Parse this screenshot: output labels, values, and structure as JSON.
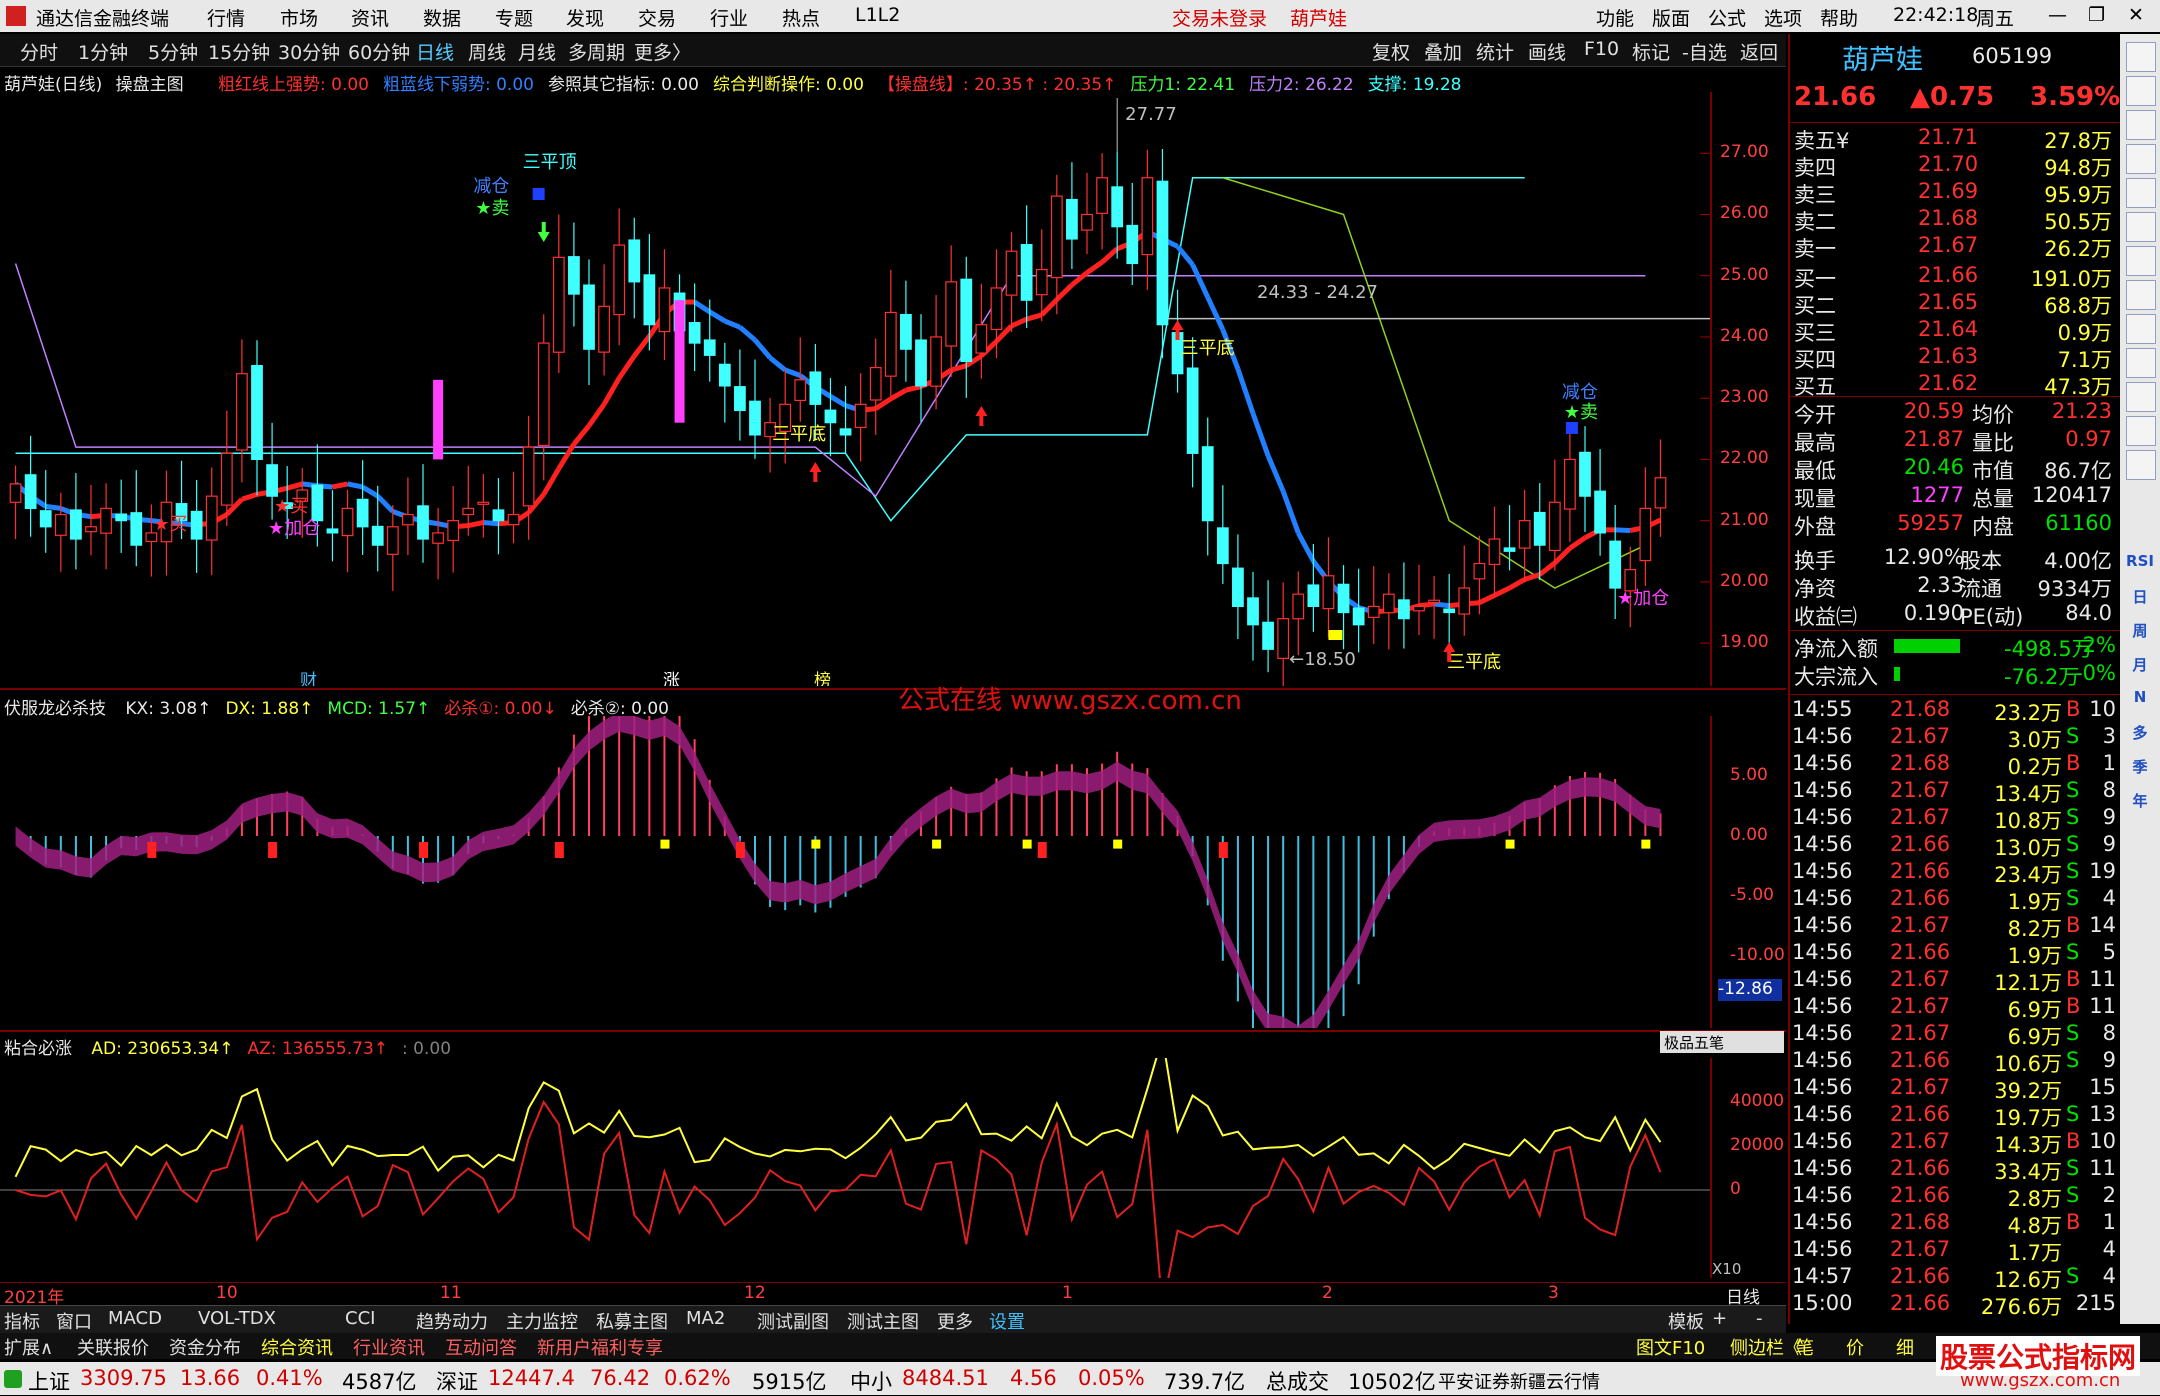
{
  "menubar": {
    "app_title": "通达信金融终端",
    "items": [
      "行情",
      "市场",
      "资讯",
      "数据",
      "专题",
      "发现",
      "交易",
      "行业",
      "热点",
      "L1L2"
    ],
    "trade_status": "交易未登录",
    "stock_name": "葫芦娃",
    "right_items": [
      "功能",
      "版面",
      "公式",
      "选项",
      "帮助"
    ],
    "time": "22:42:18",
    "weekday": "周五"
  },
  "timeframe_bar": {
    "items": [
      "分时",
      "1分钟",
      "5分钟",
      "15分钟",
      "30分钟",
      "60分钟",
      "日线",
      "周线",
      "月线",
      "多周期",
      "更多〉"
    ],
    "active": "日线",
    "right_items": [
      "复权",
      "叠加",
      "统计",
      "画线",
      "F10",
      "标记",
      "-自选",
      "返回"
    ]
  },
  "main_chart": {
    "title": "葫芦娃(日线)",
    "indicator_name": "操盘主图",
    "params": [
      {
        "text": "粗红线上强势: 0.00",
        "color": "#ff3030"
      },
      {
        "text": "粗蓝线下弱势: 0.00",
        "color": "#3080ff"
      },
      {
        "text": "参照其它指标: 0.00",
        "color": "#e8e8e8"
      },
      {
        "text": "综合判断操作: 0.00",
        "color": "#ffff40"
      },
      {
        "text": "【操盘线】: 20.35↑ : 20.35↑",
        "color": "#ff3030"
      },
      {
        "text": "压力1: 22.41",
        "color": "#40ff40"
      },
      {
        "text": "压力2: 26.22",
        "color": "#c080ff"
      },
      {
        "text": "支撑: 19.28",
        "color": "#40ffff"
      }
    ],
    "y_ticks": [
      "27.00",
      "26.00",
      "25.00",
      "24.00",
      "23.00",
      "22.00",
      "21.00",
      "20.00",
      "19.00"
    ],
    "annotations": {
      "high": "27.77",
      "low": "←18.50",
      "range": "24.33 - 24.27",
      "three_top": "三平顶",
      "three_bottom": "三平底",
      "reduce": "减仓",
      "sell": "★卖",
      "buy": "★买",
      "add": "★加仓",
      "cai": "财",
      "zhang": "涨",
      "bang": "榜"
    }
  },
  "chart_data": [
    {
      "type": "candlestick",
      "title": "葫芦娃(日线)",
      "y_ticks": [
        27.0,
        26.0,
        25.0,
        24.0,
        23.0,
        22.0,
        21.0,
        20.0,
        19.0
      ],
      "ylim": [
        18.3,
        28.0
      ],
      "x_ticks": [
        "2021年",
        "10",
        "11",
        "12",
        "1",
        "2",
        "3"
      ],
      "marked_high": 27.77,
      "marked_low": 18.5,
      "closes": [
        21.6,
        21.2,
        20.9,
        21.1,
        20.7,
        20.9,
        21.2,
        21.0,
        20.6,
        20.8,
        21.3,
        21.0,
        20.7,
        21.4,
        22.1,
        23.4,
        22.0,
        21.4,
        21.2,
        21.5,
        21.0,
        20.8,
        21.2,
        20.9,
        20.6,
        20.9,
        21.1,
        20.7,
        20.8,
        21.0,
        21.2,
        21.3,
        21.0,
        21.1,
        22.2,
        23.9,
        25.3,
        24.7,
        23.8,
        24.5,
        25.5,
        24.9,
        24.2,
        24.8,
        24.1,
        23.9,
        23.7,
        23.2,
        22.8,
        22.4,
        22.6,
        22.9,
        23.3,
        22.9,
        22.6,
        22.4,
        22.9,
        23.5,
        24.4,
        23.8,
        23.2,
        24.0,
        24.9,
        23.6,
        24.2,
        24.8,
        25.4,
        24.6,
        25.1,
        26.3,
        25.6,
        26.0,
        26.6,
        25.8,
        25.2,
        26.6,
        24.2,
        23.4,
        22.1,
        21.0,
        20.3,
        19.6,
        19.3,
        18.9,
        19.4,
        19.8,
        19.6,
        20.1,
        19.5,
        19.3,
        19.6,
        19.8,
        19.4,
        19.6,
        19.7,
        19.5,
        19.9,
        20.3,
        20.7,
        20.5,
        21.0,
        20.6,
        21.3,
        22.0,
        21.4,
        20.8,
        19.9,
        20.2,
        21.2,
        21.7
      ],
      "series": [
        {
          "name": "操盘线",
          "values_ref": "closes"
        },
        {
          "name": "压力1",
          "value": 22.41
        },
        {
          "name": "压力2",
          "value": 26.22
        },
        {
          "name": "支撑",
          "value": 19.28
        }
      ]
    },
    {
      "type": "bar",
      "title": "伏服龙必杀技",
      "params": {
        "KX": 3.08,
        "DX": 1.88,
        "MCD": 1.57,
        "必杀①": 0.0,
        "必杀②": 0.0
      },
      "y_ticks": [
        5.0,
        0.0,
        -5.0,
        -10.0
      ],
      "current_value": -12.86,
      "ylim": [
        -16,
        10
      ]
    },
    {
      "type": "line",
      "title": "粘合必涨",
      "params": {
        "AD": 230653.34,
        "AZ": 136555.73
      },
      "y_ticks": [
        40000,
        20000,
        0
      ],
      "scale": "X10"
    }
  ],
  "indicator1": {
    "title": "伏服龙必杀技",
    "params": [
      {
        "text": "KX: 3.08↑",
        "color": "#e8e8e8"
      },
      {
        "text": "DX: 1.88↑",
        "color": "#ffff40"
      },
      {
        "text": "MCD: 1.57↑",
        "color": "#40ff40"
      },
      {
        "text": "必杀①: 0.00↓",
        "color": "#ff3030"
      },
      {
        "text": "必杀②: 0.00",
        "color": "#e8e8e8"
      }
    ],
    "y_ticks": [
      "5.00",
      "0.00",
      "-5.00",
      "-10.00"
    ],
    "current": "-12.86",
    "watermark": "公式在线  www.gszx.com.cn"
  },
  "indicator2": {
    "title": "粘合必涨",
    "params": [
      {
        "text": "AD: 230653.34↑",
        "color": "#ffff40"
      },
      {
        "text": "AZ: 136555.73↑",
        "color": "#ff3030"
      },
      {
        "text": ": 0.00",
        "color": "#808080"
      }
    ],
    "y_ticks": [
      "40000",
      "20000",
      "0"
    ],
    "scale": "X10",
    "pen_toolbar": "极品五笔"
  },
  "x_axis": {
    "labels": [
      "2021年",
      "10",
      "11",
      "12",
      "1",
      "2",
      "3"
    ],
    "period": "日线"
  },
  "quote": {
    "name": "葫芦娃",
    "code": "605199",
    "price": "21.66",
    "change": "▲0.75",
    "pct": "3.59%",
    "asks": [
      {
        "label": "卖五¥",
        "price": "21.71",
        "vol": "27.8万"
      },
      {
        "label": "卖四",
        "price": "21.70",
        "vol": "94.8万"
      },
      {
        "label": "卖三",
        "price": "21.69",
        "vol": "95.9万"
      },
      {
        "label": "卖二",
        "price": "21.68",
        "vol": "50.5万"
      },
      {
        "label": "卖一",
        "price": "21.67",
        "vol": "26.2万"
      }
    ],
    "bids": [
      {
        "label": "买一",
        "price": "21.66",
        "vol": "191.0万"
      },
      {
        "label": "买二",
        "price": "21.65",
        "vol": "68.8万"
      },
      {
        "label": "买三",
        "price": "21.64",
        "vol": "0.9万"
      },
      {
        "label": "买四",
        "price": "21.63",
        "vol": "7.1万"
      },
      {
        "label": "买五",
        "price": "21.62",
        "vol": "47.3万"
      }
    ],
    "stats": [
      {
        "l1": "今开",
        "v1": "20.59",
        "c1": "#ff3030",
        "l2": "均价",
        "v2": "21.23",
        "c2": "#ff3030"
      },
      {
        "l1": "最高",
        "v1": "21.87",
        "c1": "#ff3030",
        "l2": "量比",
        "v2": "0.97",
        "c2": "#ff3030"
      },
      {
        "l1": "最低",
        "v1": "20.46",
        "c1": "#00e000",
        "l2": "市值",
        "v2": "86.7亿",
        "c2": "#e8e8e8"
      },
      {
        "l1": "现量",
        "v1": "1277",
        "c1": "#ff40ff",
        "l2": "总量",
        "v2": "120417",
        "c2": "#e8e8e8"
      },
      {
        "l1": "外盘",
        "v1": "59257",
        "c1": "#ff3030",
        "l2": "内盘",
        "v2": "61160",
        "c2": "#00e000"
      }
    ],
    "stats2": [
      {
        "l1": "换手",
        "v1": "12.90%",
        "c1": "#e8e8e8",
        "l2": "股本",
        "v2": "4.00亿",
        "c2": "#e8e8e8"
      },
      {
        "l1": "净资",
        "v1": "2.33",
        "c1": "#e8e8e8",
        "l2": "流通",
        "v2": "9334万",
        "c2": "#e8e8e8"
      },
      {
        "l1": "收益㈢",
        "v1": "0.190",
        "c1": "#e8e8e8",
        "l2": "PE(动)",
        "v2": "84.0",
        "c2": "#e8e8e8"
      }
    ],
    "flows": [
      {
        "label": "净流入额",
        "value": "-498.5万",
        "pct": "-2%",
        "fill": 0.6
      },
      {
        "label": "大宗流入",
        "value": "-76.2万",
        "pct": "-0%",
        "fill": 0.05
      }
    ],
    "ticks": [
      [
        "14:55",
        "21.68",
        "23.2万",
        "B",
        "10"
      ],
      [
        "14:56",
        "21.67",
        "3.0万",
        "S",
        "3"
      ],
      [
        "14:56",
        "21.68",
        "0.2万",
        "B",
        "1"
      ],
      [
        "14:56",
        "21.67",
        "13.4万",
        "S",
        "8"
      ],
      [
        "14:56",
        "21.67",
        "10.8万",
        "S",
        "9"
      ],
      [
        "14:56",
        "21.66",
        "13.0万",
        "S",
        "9"
      ],
      [
        "14:56",
        "21.66",
        "23.4万",
        "S",
        "19"
      ],
      [
        "14:56",
        "21.66",
        "1.9万",
        "S",
        "4"
      ],
      [
        "14:56",
        "21.67",
        "8.2万",
        "B",
        "14"
      ],
      [
        "14:56",
        "21.66",
        "1.9万",
        "S",
        "5"
      ],
      [
        "14:56",
        "21.67",
        "12.1万",
        "B",
        "11"
      ],
      [
        "14:56",
        "21.67",
        "6.9万",
        "B",
        "11"
      ],
      [
        "14:56",
        "21.67",
        "6.9万",
        "S",
        "8"
      ],
      [
        "14:56",
        "21.66",
        "10.6万",
        "S",
        "9"
      ],
      [
        "14:56",
        "21.67",
        "39.2万",
        "",
        "15"
      ],
      [
        "14:56",
        "21.66",
        "19.7万",
        "S",
        "13"
      ],
      [
        "14:56",
        "21.67",
        "14.3万",
        "B",
        "10"
      ],
      [
        "14:56",
        "21.66",
        "33.4万",
        "S",
        "11"
      ],
      [
        "14:56",
        "21.66",
        "2.8万",
        "S",
        "2"
      ],
      [
        "14:56",
        "21.68",
        "4.8万",
        "B",
        "1"
      ],
      [
        "14:56",
        "21.67",
        "1.7万",
        "",
        "4"
      ],
      [
        "14:57",
        "21.66",
        "12.6万",
        "S",
        "4"
      ],
      [
        "15:00",
        "21.66",
        "276.6万",
        "",
        "215"
      ]
    ]
  },
  "sidebar": {
    "items": [
      "RSI",
      "日",
      "周",
      "月",
      "N",
      "多",
      "季",
      "年"
    ]
  },
  "bottom_tabs": [
    "指标",
    "窗口",
    "MACD",
    "VOL-TDX",
    "CCI",
    "趋势动力",
    "主力监控",
    "私募主图",
    "MA2",
    "测试副图",
    "测试主图",
    "更多",
    "设置"
  ],
  "bottom_right": [
    "模板",
    "+",
    "-"
  ],
  "bottom_tabs2": [
    "扩展∧",
    "关联报价",
    "资金分布",
    "综合资讯",
    "行业资讯",
    "互动问答",
    "新用户福利专享"
  ],
  "bottom_right2": [
    "图文F10",
    "侧边栏《",
    "笔",
    "价",
    "细",
    "势"
  ],
  "status": {
    "sh_label": "上证",
    "sh_value": "3309.75",
    "sh_chg": "13.66",
    "sh_pct": "0.41%",
    "sh_amt": "4587亿",
    "sz_label": "深证",
    "sz_value": "12447.4",
    "sz_chg": "76.42",
    "sz_pct": "0.62%",
    "sz_amt": "5915亿",
    "zx_label": "中小",
    "zx_value": "8484.51",
    "zx_chg": "4.56",
    "zx_pct": "0.05%",
    "zx_amt": "739.7亿",
    "total_label": "总成交",
    "total_value": "10502亿",
    "broker": "平安证券新疆云行情",
    "watermark": "股票公式指标网",
    "watermark_url": "www.gszx.com.cn"
  }
}
